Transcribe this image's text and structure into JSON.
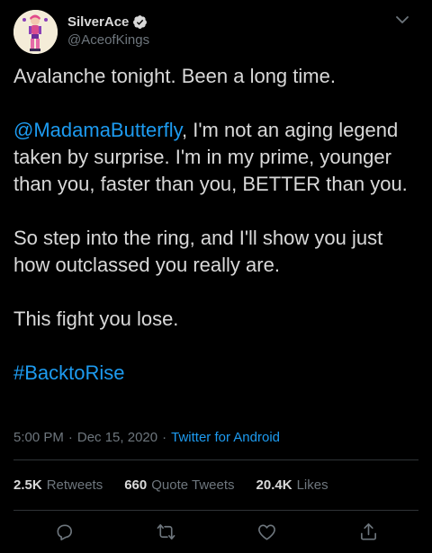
{
  "user": {
    "display_name": "SilverAce",
    "handle": "@AceofKings",
    "verified": true
  },
  "tweet": {
    "line1": "Avalanche tonight. Been a long time.",
    "mention": "@MadamaButterfly",
    "para2_rest": ", I'm not an aging legend taken by surprise. I'm in my prime, younger than you, faster than you, BETTER than you.",
    "para3": "So step into the ring, and I'll show you just how outclassed you really are.",
    "para4": "This fight you lose.",
    "hashtag": "#BacktoRise"
  },
  "meta": {
    "time": "5:00 PM",
    "separator": "·",
    "date": "Dec 15, 2020",
    "source": "Twitter for Android"
  },
  "stats": {
    "retweets_count": "2.5K",
    "retweets_label": "Retweets",
    "quotes_count": "660",
    "quotes_label": "Quote Tweets",
    "likes_count": "20.4K",
    "likes_label": "Likes"
  },
  "icons": {
    "reply": "reply-icon",
    "retweet": "retweet-icon",
    "like": "like-icon",
    "share": "share-icon",
    "more": "chevron-down-icon",
    "verified": "verified-badge-icon"
  },
  "colors": {
    "background": "#000000",
    "text": "#d9d9d9",
    "secondary": "#6e767d",
    "accent": "#1d9bf0"
  }
}
